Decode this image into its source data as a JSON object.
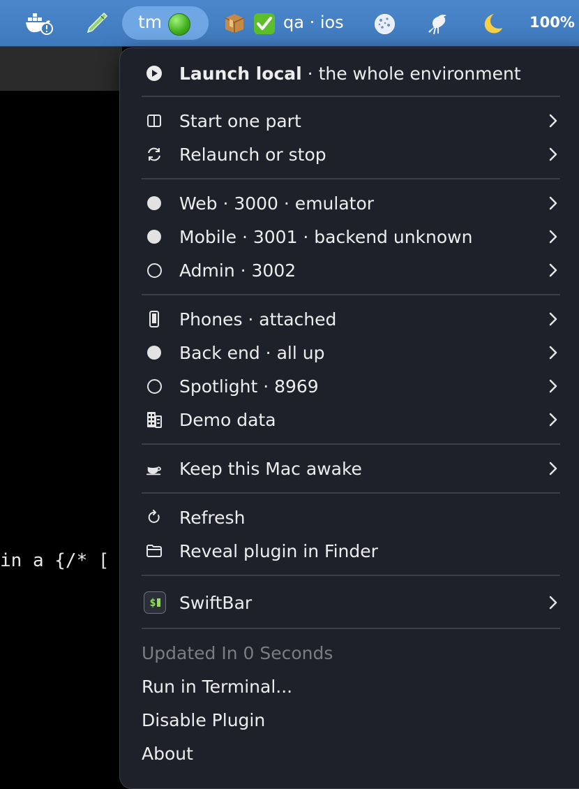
{
  "menubar": {
    "items": [
      {
        "icon": "docker-warning-icon"
      },
      {
        "icon": "pencil-icon"
      },
      {
        "icon": "box-icon"
      },
      {
        "icon": "checkmark-icon"
      },
      {
        "icon": "cookie-icon"
      },
      {
        "icon": "bird-icon"
      },
      {
        "icon": "moon-icon"
      }
    ],
    "tm_label": "tm",
    "qa_label": "qa · ios",
    "battery_label": "100%"
  },
  "background": {
    "code_text": "in a {/* ["
  },
  "menu": {
    "launch": {
      "bold": "Launch local",
      "rest": " · the whole environment",
      "icon": "play-circle-icon"
    },
    "group1": [
      {
        "label": "Start one part",
        "icon": "split-view-icon"
      },
      {
        "label": "Relaunch or stop",
        "icon": "refresh-arrows-icon"
      }
    ],
    "group2": [
      {
        "label": "Web · 3000 · emulator",
        "icon": "filled-dot-icon"
      },
      {
        "label": "Mobile · 3001 · backend unknown",
        "icon": "filled-dot-icon"
      },
      {
        "label": "Admin · 3002",
        "icon": "empty-dot-icon"
      }
    ],
    "group3": [
      {
        "label": "Phones · attached",
        "icon": "phone-icon"
      },
      {
        "label": "Back end · all up",
        "icon": "filled-dot-icon"
      },
      {
        "label": "Spotlight · 8969",
        "icon": "empty-dot-icon"
      },
      {
        "label": "Demo data",
        "icon": "building-icon"
      }
    ],
    "group4": [
      {
        "label": "Keep this Mac awake",
        "icon": "coffee-cup-icon"
      }
    ],
    "group5": [
      {
        "label": "Refresh",
        "icon": "reload-icon"
      },
      {
        "label": "Reveal plugin in Finder",
        "icon": "folder-icon"
      }
    ],
    "swiftbar": {
      "label": "SwiftBar",
      "icon": "swiftbar-app-icon",
      "icon_text": "$"
    },
    "footer": {
      "updated": "Updated In 0 Seconds",
      "run_terminal": "Run in Terminal...",
      "disable": "Disable Plugin",
      "about": "About"
    }
  }
}
